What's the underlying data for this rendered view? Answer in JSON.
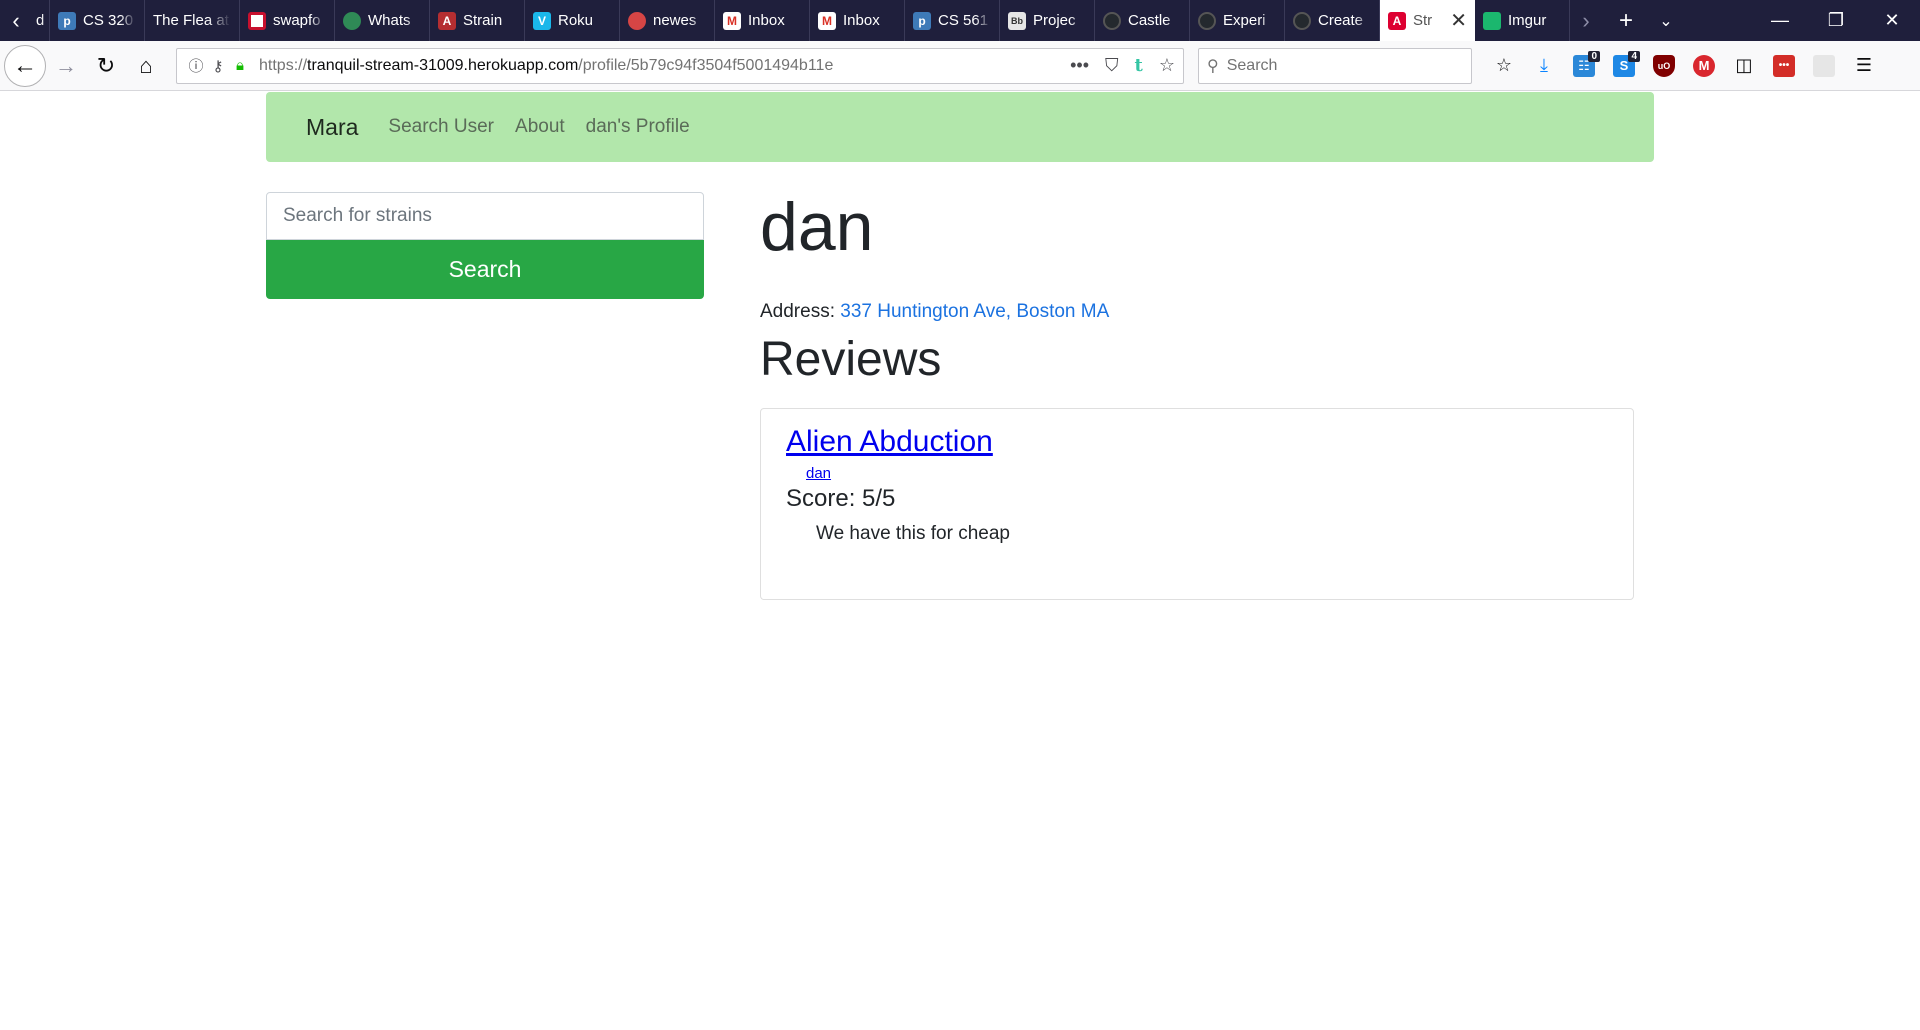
{
  "browser": {
    "tabs": [
      {
        "label": "dit",
        "favicon_icon": "partial-icon",
        "favicon_color": "#1f1f3c",
        "partial": true
      },
      {
        "label": "CS 320",
        "favicon_icon": "piazza-icon",
        "favicon_color": "#3e7ab8"
      },
      {
        "label": "The Flea at",
        "favicon_icon": "",
        "favicon_color": ""
      },
      {
        "label": "swapfo",
        "favicon_icon": "stripes-icon",
        "favicon_color": "#c8102e"
      },
      {
        "label": "Whats",
        "favicon_icon": "globe-icon",
        "favicon_color": "#2f8a56"
      },
      {
        "label": "Strain",
        "favicon_icon": "angular-icon",
        "favicon_color": "#b52e31"
      },
      {
        "label": "Roku",
        "favicon_icon": "vimeo-icon",
        "favicon_color": "#1ab7ea"
      },
      {
        "label": "newes",
        "favicon_icon": "reddit-icon",
        "favicon_color": "#d64545"
      },
      {
        "label": "Inbox",
        "favicon_icon": "gmail-icon",
        "favicon_color": "#d93025"
      },
      {
        "label": "Inbox",
        "favicon_icon": "gmail-icon",
        "favicon_color": "#d93025"
      },
      {
        "label": "CS 561",
        "favicon_icon": "piazza-icon",
        "favicon_color": "#3e7ab8"
      },
      {
        "label": "Projec",
        "favicon_icon": "blackboard-icon",
        "favicon_color": "#333333"
      },
      {
        "label": "Castle",
        "favicon_icon": "github-icon",
        "favicon_color": "#24292e"
      },
      {
        "label": "Experi",
        "favicon_icon": "github-icon",
        "favicon_color": "#24292e"
      },
      {
        "label": "Create",
        "favicon_icon": "github-icon",
        "favicon_color": "#24292e"
      },
      {
        "label": "Str",
        "favicon_icon": "angular-icon",
        "favicon_color": "#dd0031",
        "active": true
      },
      {
        "label": "Imgur",
        "favicon_icon": "imgur-icon",
        "favicon_color": "#1bb76e"
      }
    ],
    "url_prefix": "https://",
    "url_host": "tranquil-stream-31009.herokuapp.com",
    "url_path": "/profile/5b79c94f3504f5001494b11e",
    "search_placeholder": "Search",
    "badges": {
      "first_count": "0",
      "second_count": "4"
    }
  },
  "site": {
    "brand": "Mara",
    "nav": {
      "search_user": "Search User",
      "about": "About",
      "profile": "dan's Profile"
    },
    "strain_search": {
      "placeholder": "Search for strains",
      "button_label": "Search"
    },
    "colors": {
      "navbar_bg": "#b2e7ab",
      "search_button": "#28a745",
      "link": "#1b72e0"
    }
  },
  "profile": {
    "name": "dan",
    "address_label": "Address:",
    "address": "337 Huntington Ave, Boston MA",
    "reviews_heading": "Reviews",
    "reviews": [
      {
        "strain": "Alien Abduction",
        "author": "dan",
        "score": "Score: 5/5",
        "text": "We have this for cheap"
      }
    ]
  }
}
